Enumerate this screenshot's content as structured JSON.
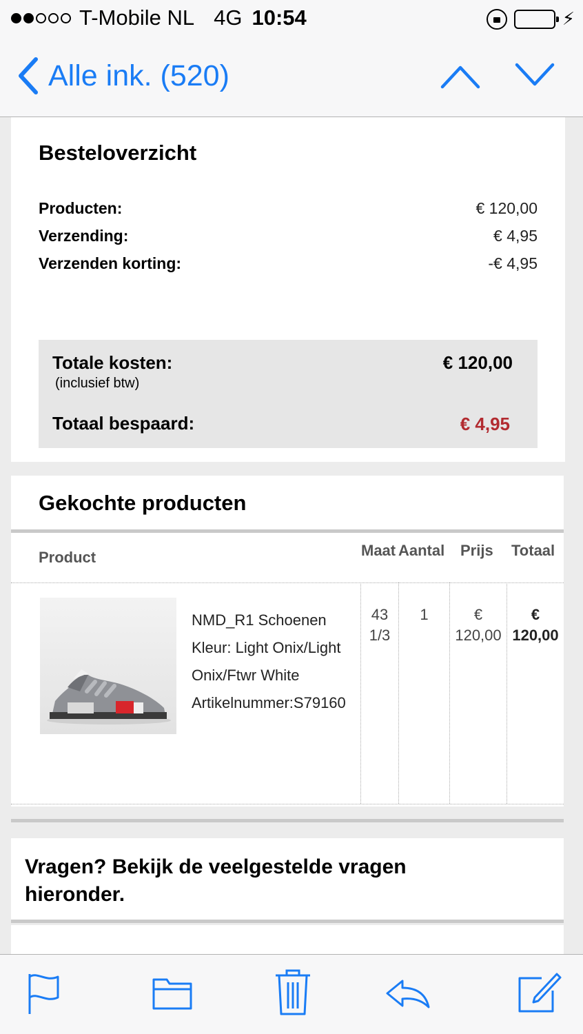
{
  "status_bar": {
    "carrier": "T-Mobile NL",
    "network": "4G",
    "time": "10:54",
    "signal_bars": 2,
    "battery_level": 0.3,
    "icons": [
      "orientation-lock-icon",
      "battery-icon",
      "charging-bolt-icon"
    ]
  },
  "nav": {
    "back_label": "Alle ink. (520)",
    "icons": [
      "chevron-left-icon",
      "chevron-up-icon",
      "chevron-down-icon"
    ],
    "accent_color": "#1a7cf5"
  },
  "summary": {
    "title": "Besteloverzicht",
    "rows": [
      {
        "label": "Producten:",
        "value": "€ 120,00"
      },
      {
        "label": "Verzending:",
        "value": "€ 4,95"
      },
      {
        "label": "Verzenden korting:",
        "value": "-€ 4,95"
      }
    ],
    "total_label": "Totale kosten:",
    "total_note": "(inclusief btw)",
    "total_value": "€ 120,00",
    "saved_label": "Totaal bespaard:",
    "saved_value": "€ 4,95",
    "saved_color": "#b22b30"
  },
  "products": {
    "title": "Gekochte producten",
    "columns": [
      "Product",
      "Maat",
      "Aantal",
      "Prijs",
      "Totaal"
    ],
    "items": [
      {
        "name": "NMD_R1 Schoenen",
        "color_line1": "Kleur: Light Onix/Light",
        "color_line2": "Onix/Ftwr White",
        "article": "Artikelnummer:S79160",
        "size_line1": "43",
        "size_line2": "1/3",
        "qty": "1",
        "price_line1": "€",
        "price_line2": "120,00",
        "total_line1": "€",
        "total_line2": "120,00"
      }
    ]
  },
  "questions": {
    "line1": "Vragen? Bekijk de veelgestelde vragen",
    "line2": "hieronder."
  },
  "toolbar": {
    "icons": [
      "flag-icon",
      "folder-icon",
      "trash-icon",
      "reply-icon",
      "compose-icon"
    ]
  }
}
